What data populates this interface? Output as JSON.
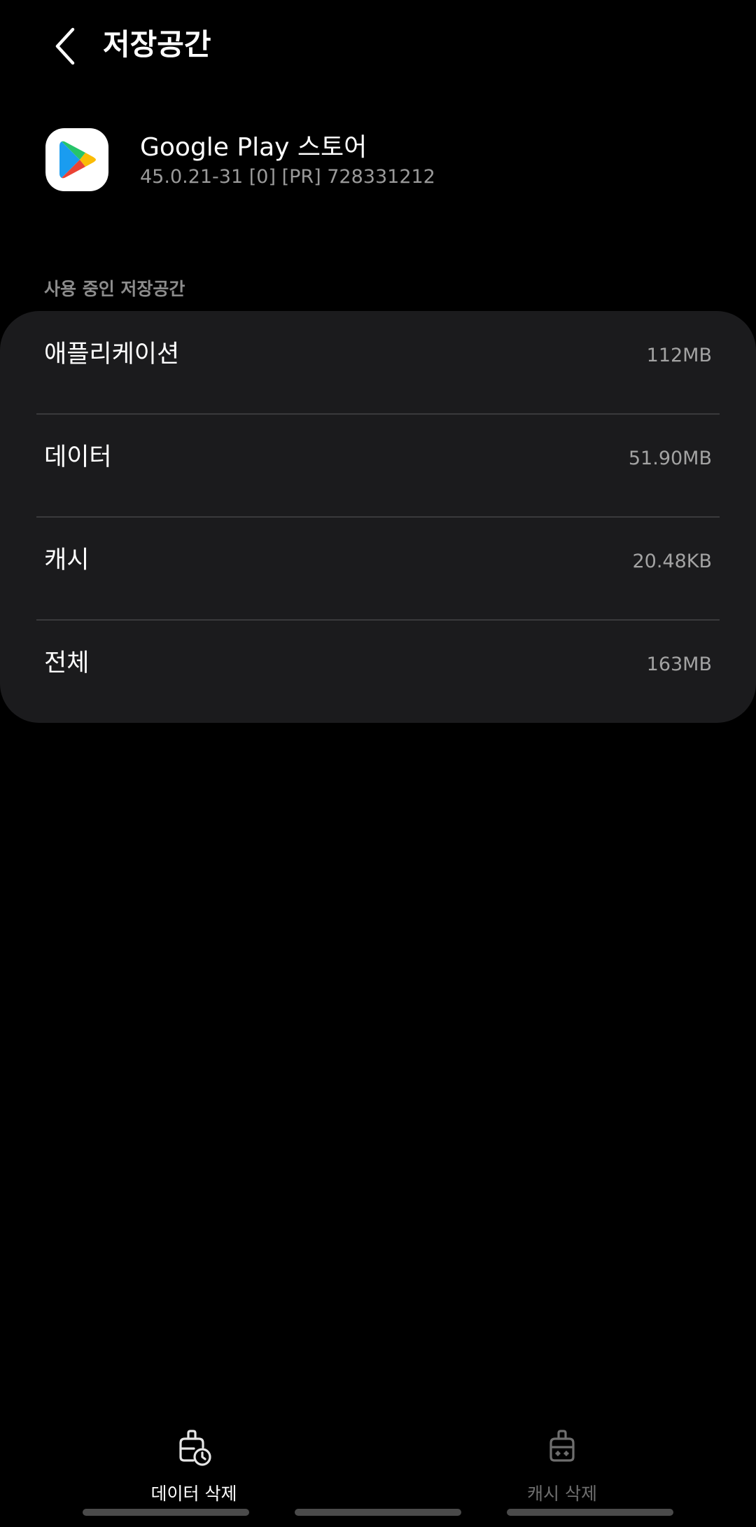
{
  "header": {
    "title": "저장공간",
    "back_icon": "chevron-left-icon"
  },
  "app": {
    "name": "Google Play 스토어",
    "version": "45.0.21-31 [0] [PR] 728331212",
    "icon": "google-play-icon"
  },
  "section": {
    "label": "사용 중인 저장공간"
  },
  "storage": {
    "rows": [
      {
        "label": "애플리케이션",
        "value": "112MB"
      },
      {
        "label": "데이터",
        "value": "51.90MB"
      },
      {
        "label": "캐시",
        "value": "20.48KB"
      },
      {
        "label": "전체",
        "value": "163MB"
      }
    ]
  },
  "actions": {
    "delete_data": {
      "label": "데이터 삭제",
      "icon": "clear-data-icon",
      "enabled": true
    },
    "delete_cache": {
      "label": "캐시 삭제",
      "icon": "clear-cache-icon",
      "enabled": false
    }
  },
  "colors": {
    "background": "#000000",
    "card": "#1b1b1d",
    "secondary_text": "#a3a3a3",
    "disabled_text": "#6e6e6e"
  }
}
